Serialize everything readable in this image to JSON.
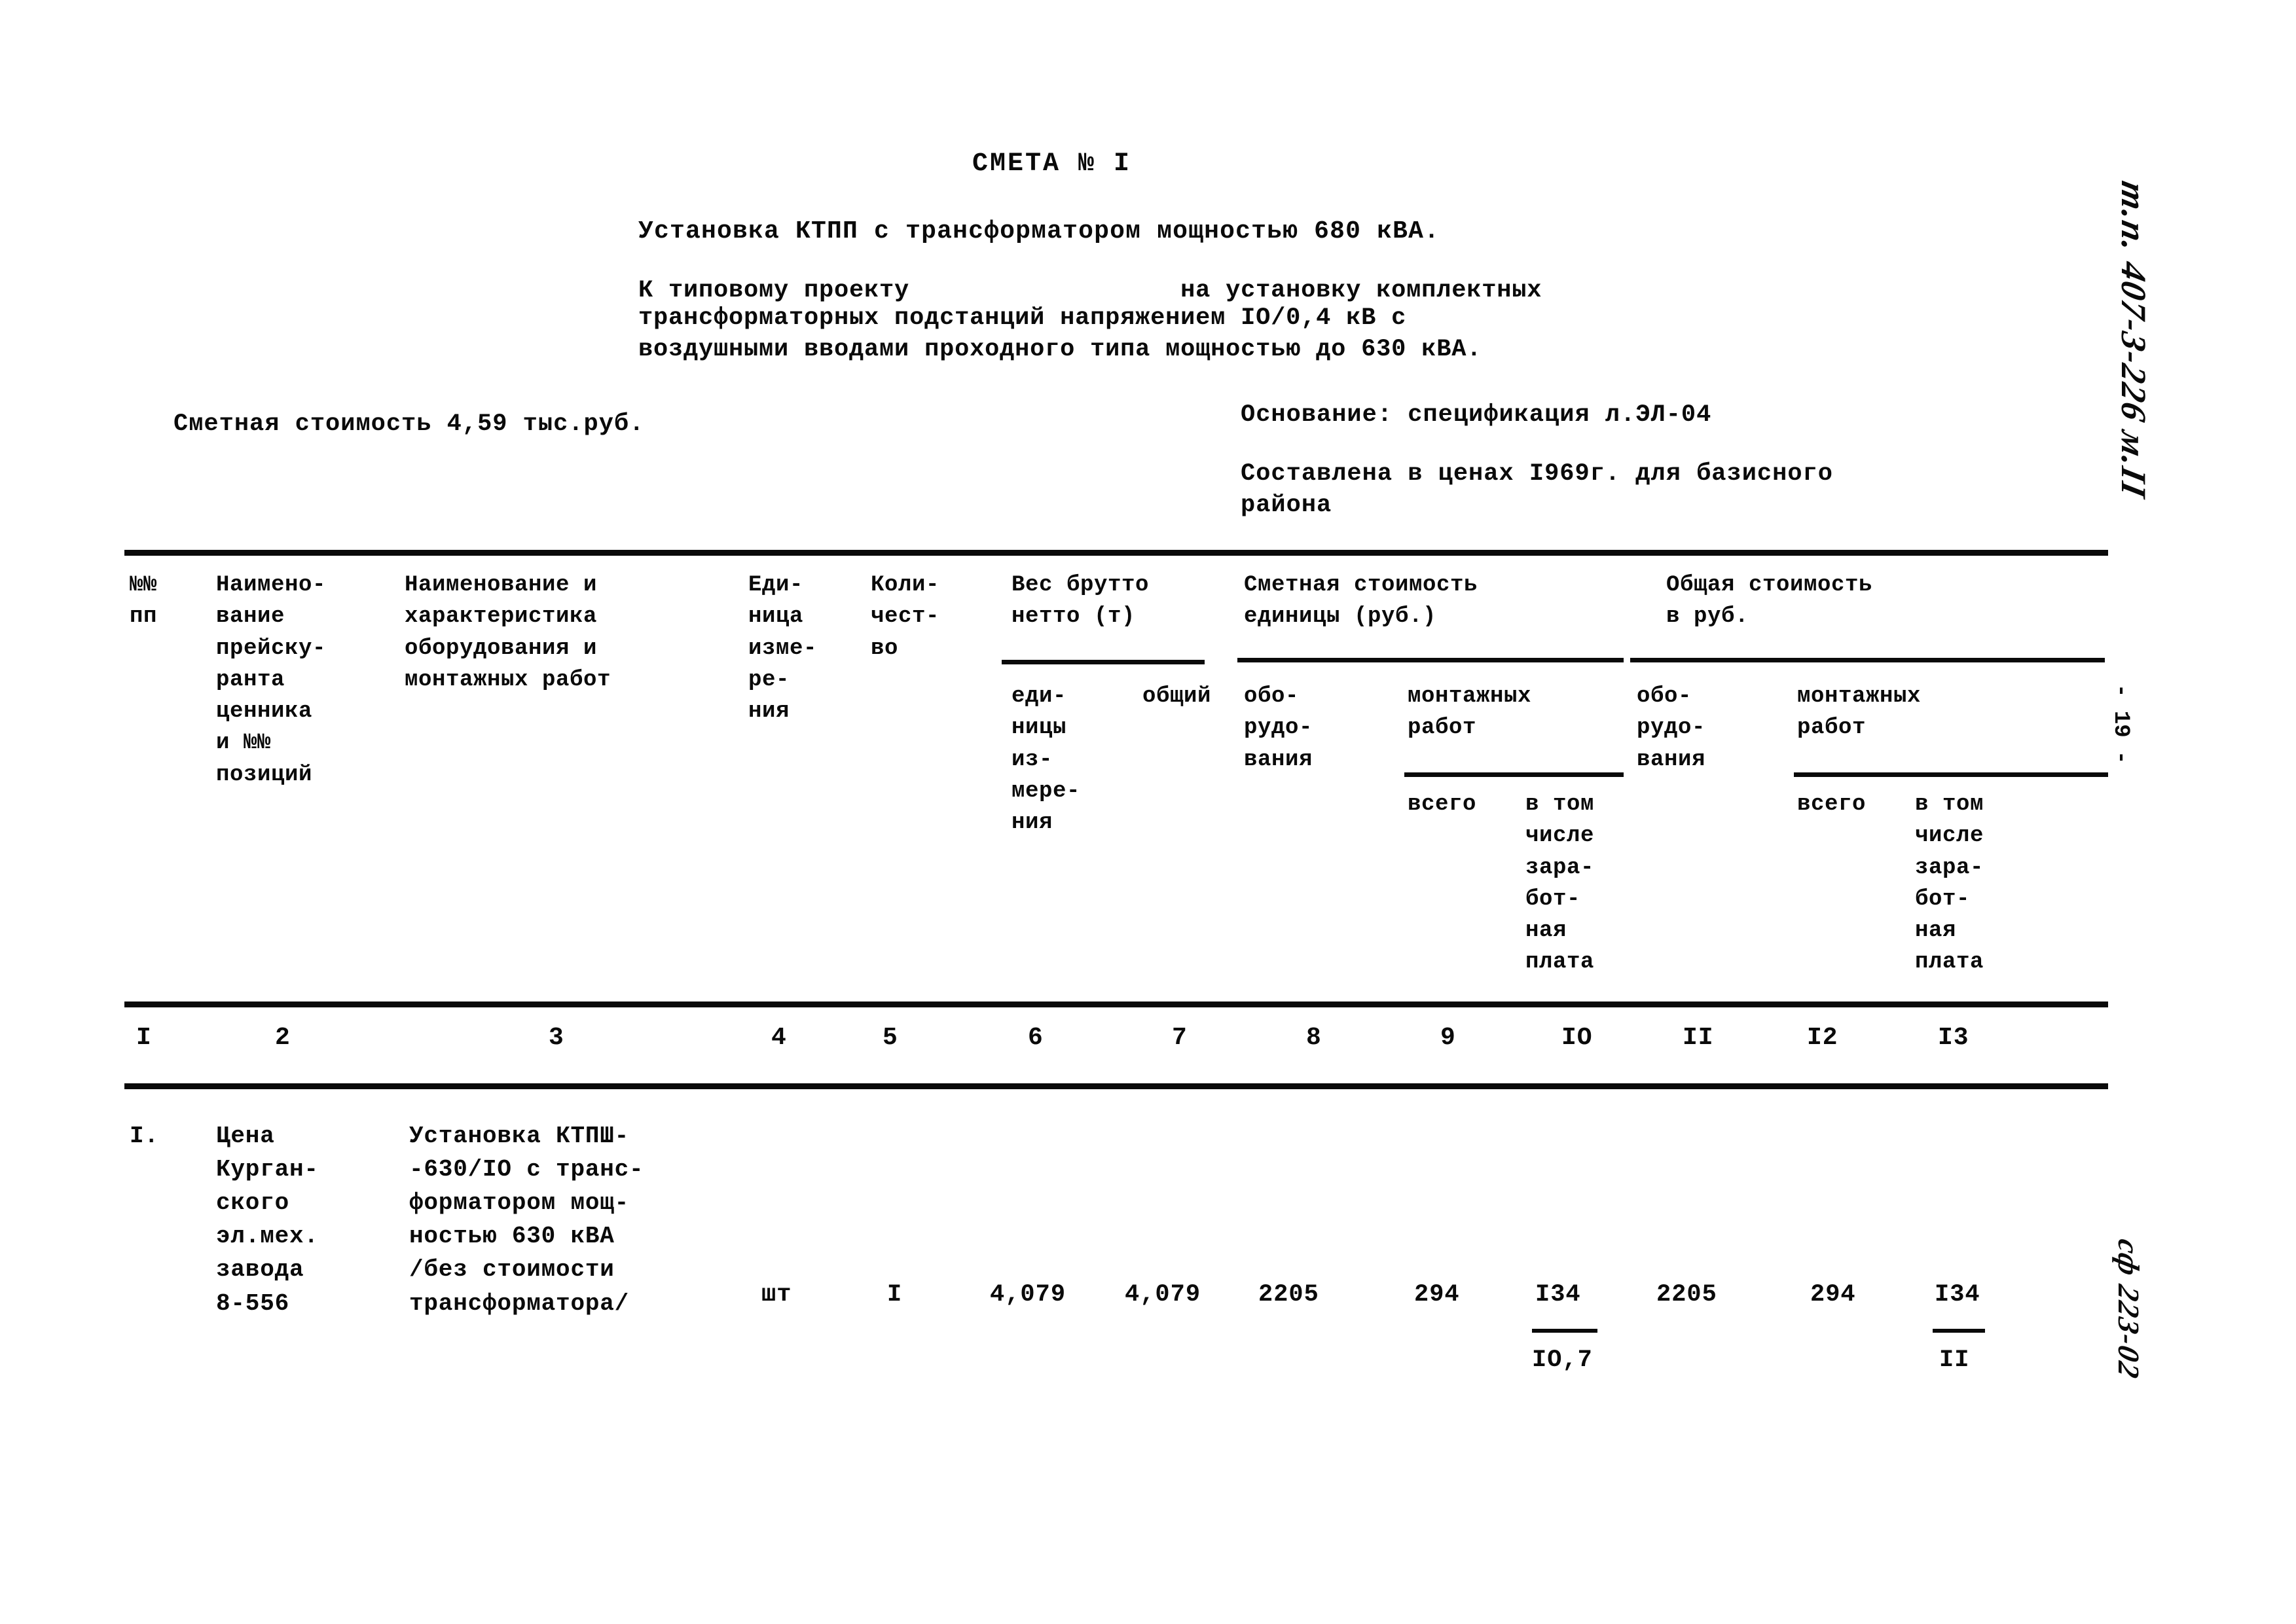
{
  "document": {
    "title": "СМЕТА № I",
    "subject": "Установка КТПП с трансформатором мощностью 680 кВА.",
    "reference_lines": [
      "К типовому проекту                  на установку комплектных",
      "трансформаторных подстанций напряжением IО/0,4 кВ с",
      "воздушными вводами проходного типа мощностью до 630 кВА."
    ],
    "estimated_cost": "Сметная стоимость 4,59 тыс.руб.",
    "basis_line_1": "Основание: спецификация л.ЭЛ-04",
    "basis_line_2": "Составлена в ценах I969г. для базисного",
    "basis_line_3": "района"
  },
  "table": {
    "headers": {
      "col1": "№№\nпп",
      "col2": "Наимено-\nвание\nпрейску-\nранта\nценника\nи №№\nпозиций",
      "col3": "Наименование и\nхарактеристика\nоборудования и\nмонтажных работ",
      "col4": "Еди-\nница\nизме-\nре-\nния",
      "col5": "Коли-\nчест-\nво",
      "group_weight": "Вес брутто\nнетто (т)",
      "col6": "еди-\nницы\nиз-\nмере-\nния",
      "col7": "общий",
      "group_unit_cost": "Сметная стоимость\nединицы (руб.)",
      "col8": "обо-\nрудо-\nвания",
      "group_install_a": "монтажных\nработ",
      "col9": "всего",
      "col10": "в том\nчисле\nзара-\nбот-\nная\nплата",
      "group_total_cost": "Общая стоимость\nв руб.",
      "col11": "обо-\nрудо-\nвания",
      "group_install_b": "монтажных\nработ",
      "col12": "всего",
      "col13": "в том\nчисле\nзара-\nбот-\nная\nплата"
    },
    "column_numbers": [
      "I",
      "2",
      "3",
      "4",
      "5",
      "6",
      "7",
      "8",
      "9",
      "IO",
      "II",
      "I2",
      "I3"
    ],
    "rows": [
      {
        "no": "I.",
        "pricelist": "Цена\nКурган-\nского\nэл.мех.\nзавода\n8-556",
        "description": "Установка КТПШ-\n-630/IО с транс-\nформатором мощ-\nностью 630 кВА\n/без стоимости\nтрансформатора/",
        "unit": "шт",
        "qty": "I",
        "weight_unit": "4,079",
        "weight_total": "4,079",
        "unit_equipment": "2205",
        "unit_install_total": "294",
        "unit_install_wage_top": "I34",
        "unit_install_wage_bottom": "IО,7",
        "total_equipment": "2205",
        "total_install_total": "294",
        "total_install_wage_top": "I34",
        "total_install_wage_bottom": "II"
      }
    ]
  },
  "margin_notes": {
    "top_right": "т.п. 407-3-226 м.II",
    "page_number": "- 19 -",
    "bottom_right": "сф 223-02"
  }
}
